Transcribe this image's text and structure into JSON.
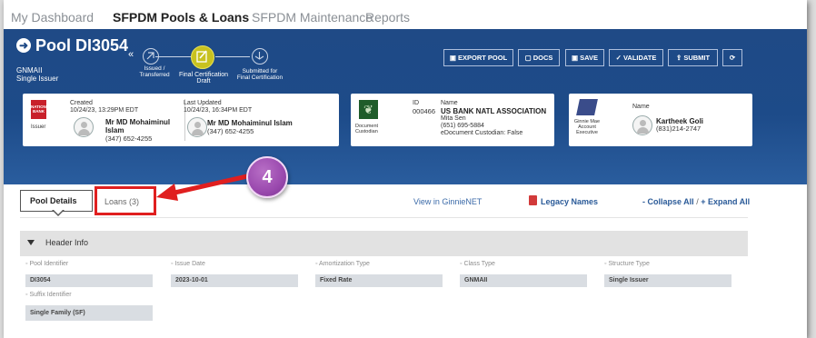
{
  "nav": {
    "items": [
      "My Dashboard",
      "SFPDM Pools & Loans",
      "SFPDM Maintenance",
      "Reports"
    ],
    "active_index": 1
  },
  "pool": {
    "title": "Pool DI3054",
    "type_line1": "GNMAII",
    "type_line2": "Single Issuer"
  },
  "workflow": {
    "steps": [
      {
        "label": "Issued /\nTransferred",
        "state": "done"
      },
      {
        "label": "Final Certification\nDraft",
        "state": "current"
      },
      {
        "label": "Submitted for\nFinal Certification",
        "state": "pending"
      }
    ]
  },
  "toolbar": {
    "export": "EXPORT POOL",
    "docs": "DOCS",
    "save": "SAVE",
    "validate": "VALIDATE",
    "submit": "SUBMIT"
  },
  "issuer_card": {
    "logo_text": "NATIONAL BANK",
    "role": "Issuer",
    "created_label": "Created",
    "created_date": "10/24/23, 13:29PM EDT",
    "created_name": "Mr MD Mohaiminul Islam",
    "created_phone": "(347) 652-4255",
    "updated_label": "Last Updated",
    "updated_date": "10/24/23, 16:34PM EDT",
    "updated_name": "Mr MD Mohaiminul Islam",
    "updated_phone": "(347) 652-4255"
  },
  "custodian_card": {
    "role_line1": "Document",
    "role_line2": "Custodian",
    "id_label": "ID",
    "id_value": "000466",
    "name_label": "Name",
    "name_value": "US BANK NATL ASSOCIATION",
    "contact": "Mita Sen",
    "phone": "(651) 695-5884",
    "edoc": "eDocument Custodian: False"
  },
  "exec_card": {
    "role_line1": "Ginnie Mae",
    "role_line2": "Account",
    "role_line3": "Executive",
    "name_label": "Name",
    "name_value": "Kartheek Goli",
    "phone": "(831)214-2747"
  },
  "tabs": {
    "pool_details": "Pool Details",
    "loans": "Loans (3)",
    "view_ginnie": "View in GinnieNET",
    "legacy": "Legacy Names",
    "collapse": "- Collapse All",
    "sep": " / ",
    "expand": "+ Expand All"
  },
  "annotation": {
    "badge": "4",
    "accent": "#e01f1f"
  },
  "header_info": {
    "title": "Header Info",
    "fields": [
      {
        "label": "Pool Identifier",
        "value": "DI3054"
      },
      {
        "label": "Issue Date",
        "value": "2023-10-01"
      },
      {
        "label": "Amortization Type",
        "value": "Fixed Rate"
      },
      {
        "label": "Class Type",
        "value": "GNMAII"
      },
      {
        "label": "Structure Type",
        "value": "Single Issuer"
      },
      {
        "label": "Suffix Identifier",
        "value": "Single Family (SF)"
      }
    ]
  }
}
